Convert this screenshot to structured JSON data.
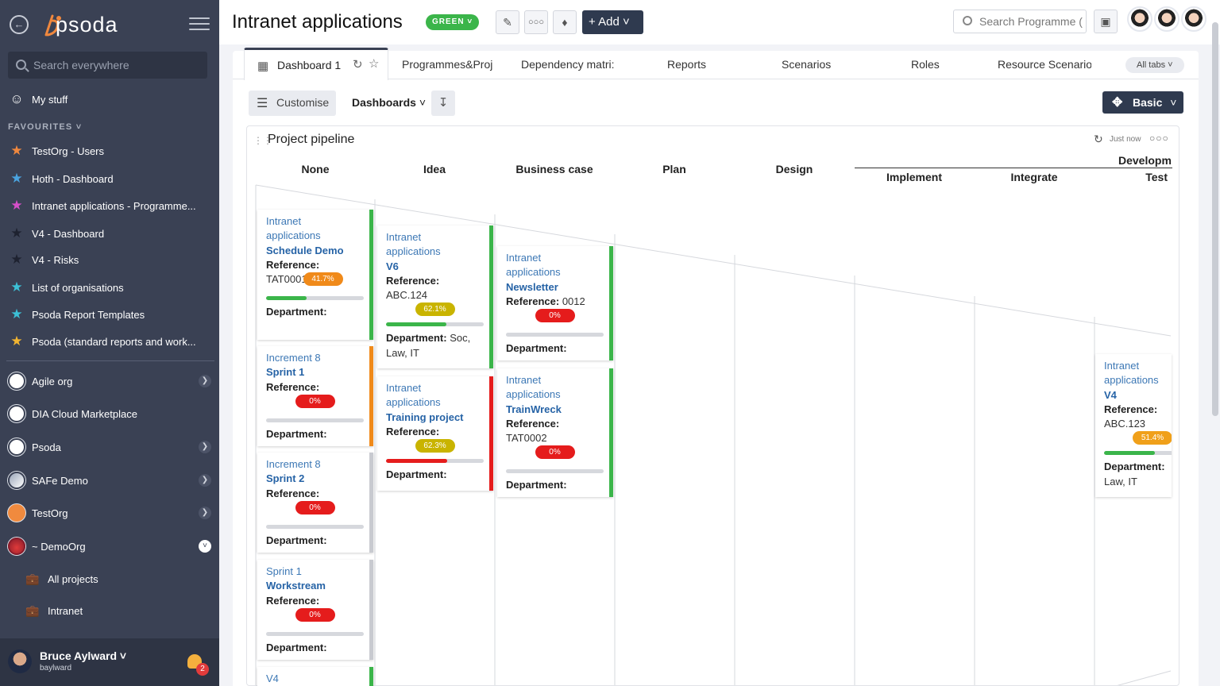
{
  "sidebar": {
    "logo": "psoda",
    "search_placeholder": "Search everywhere",
    "my_stuff": "My stuff",
    "favourites_heading": "FAVOURITES",
    "favourites": [
      {
        "label": "TestOrg - Users",
        "color": "#f0883e"
      },
      {
        "label": "Hoth - Dashboard",
        "color": "#4aa3df"
      },
      {
        "label": "Intranet applications - Programme...",
        "color": "#d64fc9"
      },
      {
        "label": "V4 - Dashboard",
        "color": "#2c2f38"
      },
      {
        "label": "V4 - Risks",
        "color": "#2c2f38"
      },
      {
        "label": "List of organisations",
        "color": "#3cc0d6"
      },
      {
        "label": "Psoda Report Templates",
        "color": "#3cc0d6"
      },
      {
        "label": "Psoda (standard reports and work...",
        "color": "#f2b531"
      }
    ],
    "orgs": [
      {
        "label": "Agile org",
        "chevron": true
      },
      {
        "label": "DIA Cloud Marketplace",
        "chevron": false
      },
      {
        "label": "Psoda",
        "chevron": true
      },
      {
        "label": "SAFe Demo",
        "chevron": true
      },
      {
        "label": "TestOrg",
        "chevron": true
      },
      {
        "label": "~ DemoOrg",
        "chevron": true
      }
    ],
    "sub_items": [
      "All projects",
      "Intranet"
    ],
    "user": {
      "name": "Bruce Aylward",
      "handle": "baylward",
      "notifications": "2"
    }
  },
  "topbar": {
    "title": "Intranet applications",
    "status_badge": "GREEN",
    "add_label": "Add",
    "search_placeholder": "Search Programme (",
    "status_color": "#3bb54a"
  },
  "tabs": {
    "items": [
      "Dashboard 1",
      "Programmes&Proj",
      "Dependency matri:",
      "Reports",
      "Scenarios",
      "Roles",
      "Resource Scenario:"
    ],
    "all_tabs": "All tabs"
  },
  "toolbar": {
    "customise": "Customise",
    "dashboards": "Dashboards",
    "view_mode": "Basic"
  },
  "widget": {
    "title": "Project pipeline",
    "refreshed": "Just now",
    "stages": [
      "None",
      "Idea",
      "Business case",
      "Plan",
      "Design",
      "Implement",
      "Integrate",
      "Test"
    ],
    "group_label": "Developm",
    "cards": [
      {
        "lines": [
          "Intranet",
          "applications"
        ],
        "name": "Schedule Demo",
        "ref_label": "Reference:",
        "ref": "TAT0001",
        "progress": "41.7%",
        "progress_value": 41.7,
        "pill_color": "#f08a1a",
        "dept_label": "Department:",
        "dept": "",
        "status_color": "#3bb54a"
      },
      {
        "lines": [
          "Increment 8"
        ],
        "name": "Sprint 1",
        "ref_label": "Reference:",
        "ref": "",
        "progress": "0%",
        "progress_value": 0,
        "pill_color": "#e51c1c",
        "dept_label": "Department:",
        "dept": "",
        "status_color": "#f08a1a"
      },
      {
        "lines": [
          "Increment 8"
        ],
        "name": "Sprint 2",
        "ref_label": "Reference:",
        "ref": "",
        "progress": "0%",
        "progress_value": 0,
        "pill_color": "#e51c1c",
        "dept_label": "Department:",
        "dept": "",
        "status_color": "#c8cad0"
      },
      {
        "lines": [
          "Sprint 1"
        ],
        "name": "Workstream",
        "ref_label": "Reference:",
        "ref": "",
        "progress": "0%",
        "progress_value": 0,
        "pill_color": "#e51c1c",
        "dept_label": "Department:",
        "dept": "",
        "status_color": "#c8cad0"
      },
      {
        "lines": [
          "V4"
        ],
        "name": "",
        "ref_label": "",
        "ref": "",
        "progress": "",
        "progress_value": 0,
        "pill_color": "",
        "dept_label": "",
        "dept": "",
        "status_color": "#3bb54a"
      },
      {
        "lines": [
          "Intranet",
          "applications"
        ],
        "name": "V6",
        "ref_label": "Reference:",
        "ref": "ABC.124",
        "progress": "62.1%",
        "progress_value": 62.1,
        "pill_color": "#c9b400",
        "dept_label": "Department:",
        "dept": "Soc, Law, IT",
        "status_color": "#3bb54a"
      },
      {
        "lines": [
          "Intranet",
          "applications"
        ],
        "name": "Training project",
        "ref_label": "Reference:",
        "ref": "",
        "progress": "62.3%",
        "progress_value": 62.3,
        "pill_color": "#c9b400",
        "dept_label": "Department:",
        "dept": "",
        "status_color": "#e51c1c"
      },
      {
        "lines": [
          "Intranet",
          "applications"
        ],
        "name": "Newsletter",
        "ref_label": "Reference:",
        "ref": "0012",
        "progress": "0%",
        "progress_value": 0,
        "pill_color": "#e51c1c",
        "dept_label": "Department:",
        "dept": "",
        "status_color": "#3bb54a"
      },
      {
        "lines": [
          "Intranet",
          "applications"
        ],
        "name": "TrainWreck",
        "ref_label": "Reference:",
        "ref": "TAT0002",
        "progress": "0%",
        "progress_value": 0,
        "pill_color": "#e51c1c",
        "dept_label": "Department:",
        "dept": "",
        "status_color": "#3bb54a"
      },
      {
        "lines": [
          "Intranet",
          "applications"
        ],
        "name": "V4",
        "ref_label": "Reference:",
        "ref": "ABC.123",
        "progress": "51.4%",
        "progress_value": 51.4,
        "pill_color": "#f0a01a",
        "dept_label": "Department:",
        "dept": "Law, IT",
        "status_color": "#ffffff"
      }
    ]
  }
}
